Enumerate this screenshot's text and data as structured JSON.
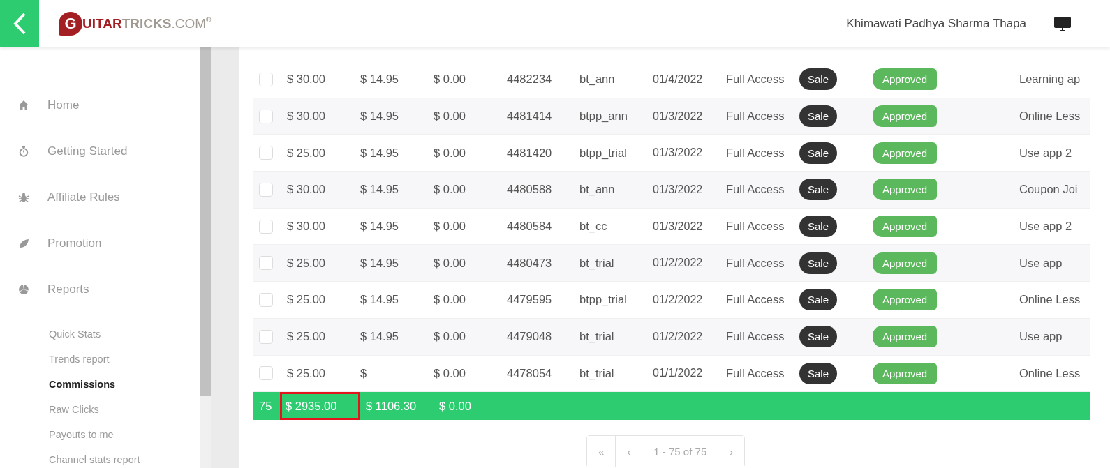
{
  "header": {
    "logo": {
      "initial": "G",
      "word_1": "UITAR",
      "word_2": "TRICKS",
      ".com": ".COM",
      "mark": "®"
    },
    "user": "Khimawati Padhya Sharma Thapa"
  },
  "sidebar": {
    "items": [
      {
        "label": "Home"
      },
      {
        "label": "Getting Started"
      },
      {
        "label": "Affiliate Rules"
      },
      {
        "label": "Promotion"
      },
      {
        "label": "Reports"
      }
    ],
    "subitems": [
      {
        "label": "Quick Stats",
        "selected": false
      },
      {
        "label": "Trends report",
        "selected": false
      },
      {
        "label": "Commissions",
        "selected": true
      },
      {
        "label": "Raw Clicks",
        "selected": false
      },
      {
        "label": "Payouts to me",
        "selected": false
      },
      {
        "label": "Channel stats report",
        "selected": false
      }
    ]
  },
  "table": {
    "rows": [
      {
        "checked": false,
        "amount": "$ 30.00",
        "commission": "$ 14.95",
        "column_3": "$ 0.00",
        "id": "4482234",
        "code": "bt_ann",
        "date": "01/4/2022",
        "product": "Full Access",
        "type": "Sale",
        "status": "Approved",
        "note": "Learning ap"
      },
      {
        "checked": false,
        "amount": "$ 30.00",
        "commission": "$ 14.95",
        "column_3": "$ 0.00",
        "id": "4481414",
        "code": "btpp_ann",
        "date": "01/3/2022",
        "product": "Full Access",
        "type": "Sale",
        "status": "Approved",
        "note": "Online Less"
      },
      {
        "checked": false,
        "amount": "$ 25.00",
        "commission": "$ 14.95",
        "column_3": "$ 0.00",
        "id": "4481420",
        "code": "btpp_trial",
        "date": "01/3/2022",
        "product": "Full Access",
        "type": "Sale",
        "status": "Approved",
        "note": "Use app 2"
      },
      {
        "checked": false,
        "amount": "$ 30.00",
        "commission": "$ 14.95",
        "column_3": "$ 0.00",
        "id": "4480588",
        "code": "bt_ann",
        "date": "01/3/2022",
        "product": "Full Access",
        "type": "Sale",
        "status": "Approved",
        "note": "Coupon Joi"
      },
      {
        "checked": false,
        "amount": "$ 30.00",
        "commission": "$ 14.95",
        "column_3": "$ 0.00",
        "id": "4480584",
        "code": "bt_cc",
        "date": "01/3/2022",
        "product": "Full Access",
        "type": "Sale",
        "status": "Approved",
        "note": "Use app 2"
      },
      {
        "checked": false,
        "amount": "$ 25.00",
        "commission": "$ 14.95",
        "column_3": "$ 0.00",
        "id": "4480473",
        "code": "bt_trial",
        "date": "01/2/2022",
        "product": "Full Access",
        "type": "Sale",
        "status": "Approved",
        "note": "Use app"
      },
      {
        "checked": false,
        "amount": "$ 25.00",
        "commission": "$ 14.95",
        "column_3": "$ 0.00",
        "id": "4479595",
        "code": "btpp_trial",
        "date": "01/2/2022",
        "product": "Full Access",
        "type": "Sale",
        "status": "Approved",
        "note": "Online Less"
      },
      {
        "checked": false,
        "amount": "$ 25.00",
        "commission": "$ 14.95",
        "column_3": "$ 0.00",
        "id": "4479048",
        "code": "bt_trial",
        "date": "01/2/2022",
        "product": "Full Access",
        "type": "Sale",
        "status": "Approved",
        "note": "Use app"
      },
      {
        "checked": false,
        "amount": "$ 25.00",
        "commission": "$",
        "column_3": "$ 0.00",
        "id": "4478054",
        "code": "bt_trial",
        "date": "01/1/2022",
        "product": "Full Access",
        "type": "Sale",
        "status": "Approved",
        "note": "Online Less"
      }
    ],
    "totals": {
      "count": "75",
      "amount": "$ 2935.00",
      "amount_highlighted": true,
      "commission": "$ 1106.30",
      "column_3": "$ 0.00"
    }
  },
  "pagination": {
    "first": "«",
    "prev": "‹",
    "range": "1 - 75 of 75",
    "next": "›"
  }
}
